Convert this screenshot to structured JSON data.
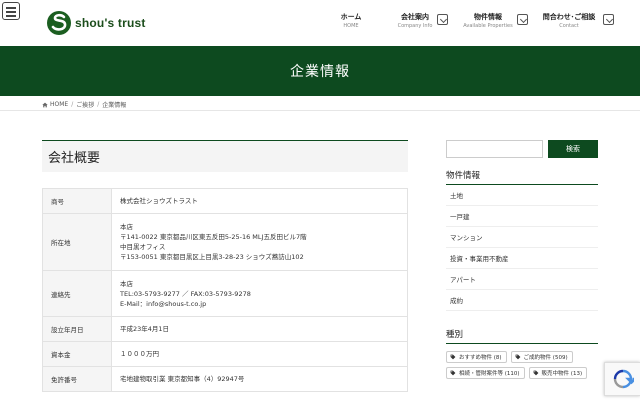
{
  "brand": {
    "name": "shou's trust"
  },
  "nav": [
    {
      "label": "ホーム",
      "sub": "HOME",
      "dropdown": false,
      "active": false
    },
    {
      "label": "会社案内",
      "sub": "Company Info",
      "dropdown": true,
      "active": true
    },
    {
      "label": "物件情報",
      "sub": "Available Properties",
      "dropdown": true,
      "active": false
    },
    {
      "label": "問合わせ･ご相談",
      "sub": "Contact",
      "dropdown": true,
      "active": false
    }
  ],
  "hero": {
    "title": "企業情報"
  },
  "breadcrumb": [
    "HOME",
    "ご挨拶",
    "企業情報"
  ],
  "main": {
    "section_title": "会社概要",
    "rows": [
      {
        "label": "商号",
        "lines": [
          "株式会社ショウズトラスト"
        ]
      },
      {
        "label": "所在地",
        "lines": [
          "本店",
          "〒141-0022 東京都品川区東五反田5-25-16 MLJ五反田ビル7階",
          "中目黒オフィス",
          "〒153-0051 東京都目黒区上目黒3-28-23 ショウズ蕎訪山102"
        ]
      },
      {
        "label": "連絡先",
        "lines": [
          "本店",
          "TEL:03-5793-9277 ／ FAX:03-5793-9278",
          "E-Mail：info@shous-t.co.jp"
        ]
      },
      {
        "label": "設立年月日",
        "lines": [
          "平成23年4月1日"
        ]
      },
      {
        "label": "資本金",
        "lines": [
          "１０００万円"
        ]
      },
      {
        "label": "免許番号",
        "lines": [
          "宅地建物取引業 東京都知事（4）92947号"
        ]
      }
    ]
  },
  "sidebar": {
    "search_button": "検索",
    "search_placeholder": "",
    "property_heading": "物件情報",
    "property_items": [
      "土地",
      "一戸建",
      "マンション",
      "投資・事業用不動産",
      "アパート",
      "成約"
    ],
    "category_heading": "種別",
    "tags": [
      "おすすめ物件 (8)",
      "ご成約物件 (509)",
      "相続・管財案件等 (110)",
      "販売中物件 (13)"
    ]
  },
  "colors": {
    "brand_green": "#0d4a1f",
    "accent_green": "#2e6b3a"
  }
}
